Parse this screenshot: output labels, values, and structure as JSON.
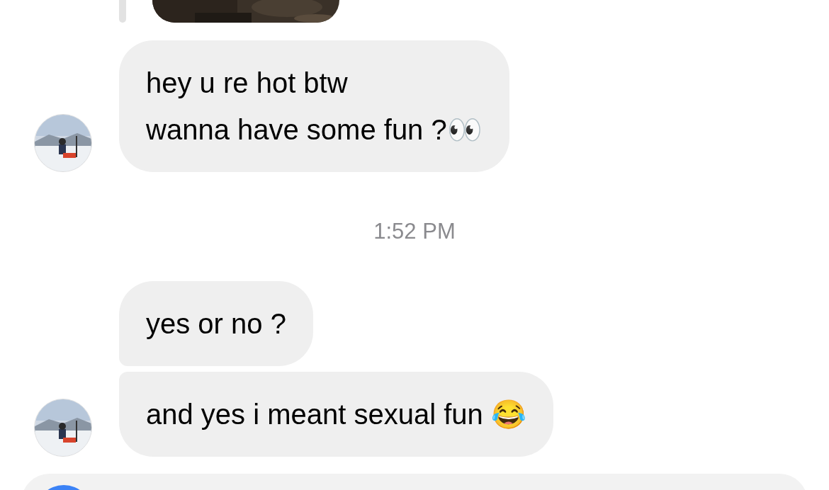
{
  "reply_preview": {
    "kind": "picture"
  },
  "groups": [
    {
      "messages": [
        "hey u re hot btw\nwanna have some fun ?👀"
      ],
      "avatar": {
        "kind": "picture"
      }
    },
    {
      "timestamp": "1:52 PM"
    },
    {
      "messages": [
        "yes or no ?",
        "and yes i meant sexual fun 😂"
      ],
      "avatar": {
        "kind": "picture"
      }
    }
  ]
}
